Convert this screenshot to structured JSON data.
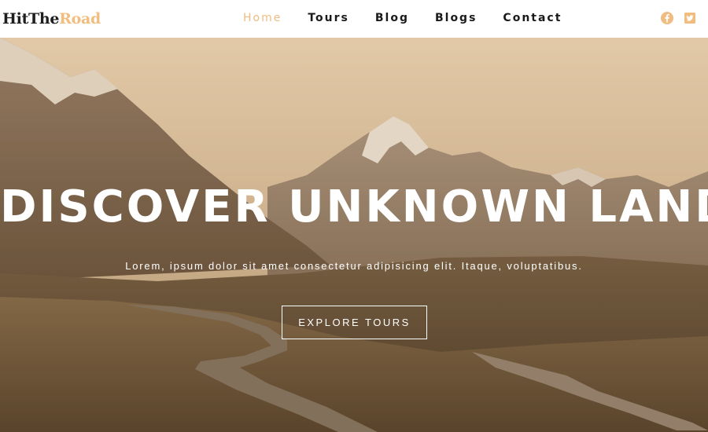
{
  "brand": {
    "part1": "HitThe",
    "part2": "Road"
  },
  "nav": {
    "items": [
      {
        "label": "Home",
        "active": true
      },
      {
        "label": "Tours"
      },
      {
        "label": "Blog"
      },
      {
        "label": "Blogs"
      },
      {
        "label": "Contact"
      }
    ]
  },
  "social": {
    "icons": [
      "facebook-icon",
      "twitter-icon"
    ]
  },
  "hero": {
    "title": "DISCOVER UNKNOWN LANDS",
    "subtitle": "Lorem, ipsum dolor sit amet consectetur adipisicing elit. Itaque, voluptatibus.",
    "button_label": "EXPLORE TOURS"
  },
  "colors": {
    "accent": "#f0bc80",
    "nav_text": "#1a1a1a",
    "overlay": "#c8a070"
  }
}
